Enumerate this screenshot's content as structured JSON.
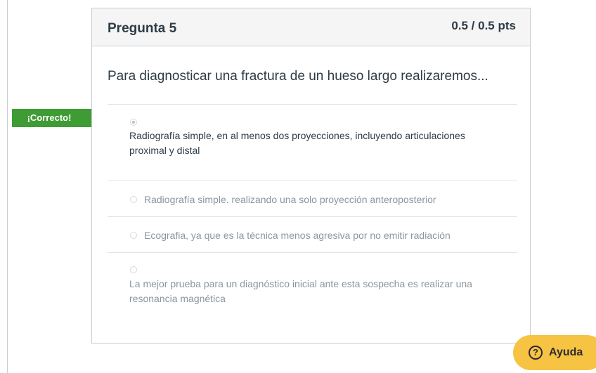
{
  "question": {
    "title": "Pregunta 5",
    "points": "0.5 / 0.5 pts",
    "text": "Para diagnosticar una fractura de un hueso largo realizaremos..."
  },
  "correct_flag": "¡Correcto!",
  "answers": [
    {
      "text": "Radiografía simple, en al menos dos proyecciones, incluyendo articulaciones proximal y distal",
      "selected": true,
      "status": "correct"
    },
    {
      "text": "Radiografía simple. realizando una solo proyección anteroposterior",
      "selected": false
    },
    {
      "text": "Ecografia, ya que es la técnica menos agresiva por no emitir radiación",
      "selected": false
    },
    {
      "text": "La mejor prueba para un diagnóstico inicial ante esta sospecha es realizar una resonancia magnética",
      "selected": false
    }
  ],
  "help": {
    "icon": "question-circle-icon",
    "label": "Ayuda"
  },
  "colors": {
    "correct_flag": "#3f9c35",
    "help_button": "#f6c343",
    "header_bg": "#f5f5f5"
  }
}
